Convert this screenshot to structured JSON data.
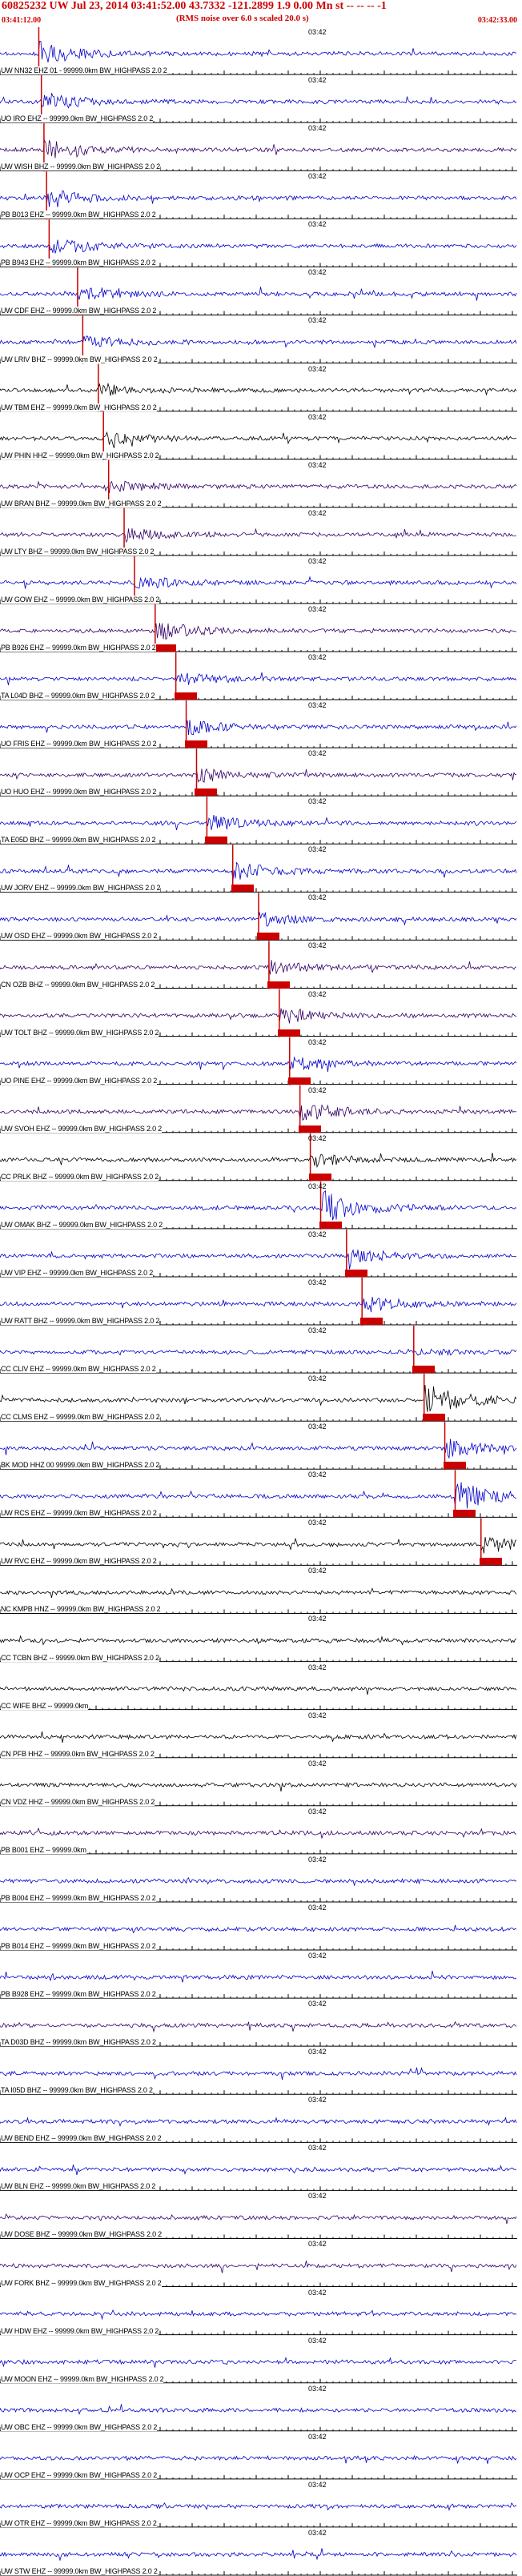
{
  "header": {
    "title": "60825232 UW Jul 23, 2014 03:41:52.00   43.7332 -121.2899  1.9 0.00 Mn st -- -- -- -1",
    "note": "(RMS noise over 6.0 s scaled 20.0 s)",
    "start_time": "03:41:12.00",
    "end_time": "03:42:33.00"
  },
  "time_marker": "03:42",
  "colors": {
    "pick": "#cc0000",
    "blue": "#0000cc",
    "purple": "#330066",
    "black": "#000000"
  },
  "traces": [
    {
      "label": "UW NN32 EHZ 01 - 99999.0km BW_HIGHPASS  2.0  2",
      "color": "blue",
      "pick": 0.075,
      "amp": 14
    },
    {
      "label": "UO IRO EHZ -- 99999.0km BW_HIGHPASS  2.0  2",
      "color": "blue",
      "pick": 0.08,
      "amp": 12
    },
    {
      "label": "UW WISH BHZ -- 99999.0km BW_HIGHPASS  2.0  2",
      "color": "purple",
      "pick": 0.085,
      "amp": 12
    },
    {
      "label": "PB B013 EHZ -- 99999.0km BW_HIGHPASS  2.0  2",
      "color": "blue",
      "pick": 0.09,
      "amp": 12
    },
    {
      "label": "PB B943 EHZ -- 99999.0km BW_HIGHPASS  2.0  2",
      "color": "blue",
      "pick": 0.095,
      "amp": 12
    },
    {
      "label": "UW CDF EHZ -- 99999.0km BW_HIGHPASS  2.0  2",
      "color": "blue",
      "pick": 0.15,
      "amp": 8
    },
    {
      "label": "UW LRIV BHZ -- 99999.0km BW_HIGHPASS  2.0  2",
      "color": "blue",
      "pick": 0.16,
      "amp": 8
    },
    {
      "label": "UW TBM EHZ -- 99999.0km BW_HIGHPASS  2.0  2",
      "color": "black",
      "pick": 0.19,
      "amp": 8
    },
    {
      "label": "UW PHIN HHZ -- 99999.0km BW_HIGHPASS  2.0  2",
      "color": "black",
      "pick": 0.2,
      "amp": 8
    },
    {
      "label": "UW BRAN BHZ -- 99999.0km BW_HIGHPASS  2.0  2",
      "color": "purple",
      "pick": 0.21,
      "amp": 8
    },
    {
      "label": "UW LTY BHZ -- 99999.0km BW_HIGHPASS  2.0  2",
      "color": "purple",
      "pick": 0.24,
      "amp": 8
    },
    {
      "label": "UW GOW EHZ -- 99999.0km BW_HIGHPASS  2.0  2",
      "color": "blue",
      "pick": 0.26,
      "amp": 8
    },
    {
      "label": "PB B926 EHZ -- 99999.0km BW_HIGHPASS  2.0  2",
      "color": "purple",
      "pick": 0.3,
      "amp": 12
    },
    {
      "label": "TA L04D BHZ -- 99999.0km BW_HIGHPASS  2.0  2",
      "color": "blue",
      "pick": 0.34,
      "amp": 8
    },
    {
      "label": "UO FRIS EHZ -- 99999.0km BW_HIGHPASS  2.0  2",
      "color": "blue",
      "pick": 0.36,
      "amp": 10
    },
    {
      "label": "UO HUO EHZ -- 99999.0km BW_HIGHPASS  2.0  2",
      "color": "purple",
      "pick": 0.38,
      "amp": 8
    },
    {
      "label": "TA E05D BHZ -- 99999.0km BW_HIGHPASS  2.0  2",
      "color": "blue",
      "pick": 0.4,
      "amp": 10
    },
    {
      "label": "UW JORV EHZ -- 99999.0km BW_HIGHPASS  2.0  2",
      "color": "blue",
      "pick": 0.45,
      "amp": 12
    },
    {
      "label": "UW OSD EHZ -- 99999.0km BW_HIGHPASS  2.0  2",
      "color": "blue",
      "pick": 0.5,
      "amp": 8
    },
    {
      "label": "CN OZB BHZ -- 99999.0km BW_HIGHPASS  2.0  2",
      "color": "purple",
      "pick": 0.52,
      "amp": 8
    },
    {
      "label": "UW TOLT BHZ -- 99999.0km BW_HIGHPASS  2.0  2",
      "color": "purple",
      "pick": 0.54,
      "amp": 10
    },
    {
      "label": "UO PINE EHZ -- 99999.0km BW_HIGHPASS  2.0  2",
      "color": "blue",
      "pick": 0.56,
      "amp": 8
    },
    {
      "label": "UW SVOH EHZ -- 99999.0km BW_HIGHPASS  2.0  2",
      "color": "purple",
      "pick": 0.58,
      "amp": 12
    },
    {
      "label": "CC PRLK BHZ -- 99999.0km BW_HIGHPASS  2.0  2",
      "color": "black",
      "pick": 0.6,
      "amp": 8
    },
    {
      "label": "UW OMAK BHZ -- 99999.0km BW_HIGHPASS  2.0  2",
      "color": "blue",
      "pick": 0.62,
      "amp": 22
    },
    {
      "label": "UW VIP EHZ -- 99999.0km BW_HIGHPASS  2.0  2",
      "color": "blue",
      "pick": 0.67,
      "amp": 10
    },
    {
      "label": "UW RATT BHZ -- 99999.0km BW_HIGHPASS  2.0  2",
      "color": "blue",
      "pick": 0.7,
      "amp": 12
    },
    {
      "label": "CC CLIV EHZ -- 99999.0km BW_HIGHPASS  2.0  2",
      "color": "blue",
      "pick": 0.8,
      "amp": 4
    },
    {
      "label": "CC CLMS EHZ -- 99999.0km BW_HIGHPASS  2.0  2",
      "color": "black",
      "pick": 0.82,
      "amp": 20
    },
    {
      "label": "BK MOD HHZ 00 99999.0km BW_HIGHPASS  2.0  2",
      "color": "blue",
      "pick": 0.86,
      "amp": 12
    },
    {
      "label": "UW RCS EHZ -- 99999.0km BW_HIGHPASS  2.0  2",
      "color": "blue",
      "pick": 0.88,
      "amp": 18
    },
    {
      "label": "UW RVC EHZ -- 99999.0km BW_HIGHPASS  2.0  2",
      "color": "black",
      "pick": 0.93,
      "amp": 10
    },
    {
      "label": "NC KMPB HNZ -- 99999.0km BW_HIGHPASS  2.0  2",
      "color": "black",
      "pick": null,
      "amp": 6
    },
    {
      "label": "CC TCBN BHZ -- 99999.0km BW_HIGHPASS  2.0  2",
      "color": "black",
      "pick": null,
      "amp": 1
    },
    {
      "label": "CC WIFE BHZ -- 99999.0km",
      "color": "black",
      "pick": null,
      "amp": 3
    },
    {
      "label": "CN PFB HHZ -- 99999.0km BW_HIGHPASS  2.0  2",
      "color": "black",
      "pick": null,
      "amp": 3
    },
    {
      "label": "CN VDZ HHZ -- 99999.0km BW_HIGHPASS  2.0  2",
      "color": "black",
      "pick": null,
      "amp": 3
    },
    {
      "label": "PB B001 EHZ -- 99999.0km",
      "color": "purple",
      "pick": null,
      "amp": 3
    },
    {
      "label": "PB B004 EHZ -- 99999.0km BW_HIGHPASS  2.0  2",
      "color": "blue",
      "pick": null,
      "amp": 3
    },
    {
      "label": "PB B014 EHZ -- 99999.0km BW_HIGHPASS  2.0  2",
      "color": "blue",
      "pick": null,
      "amp": 3
    },
    {
      "label": "PB B928 EHZ -- 99999.0km BW_HIGHPASS  2.0  2",
      "color": "blue",
      "pick": null,
      "amp": 3
    },
    {
      "label": "TA D03D BHZ -- 99999.0km BW_HIGHPASS  2.0  2",
      "color": "purple",
      "pick": null,
      "amp": 3
    },
    {
      "label": "TA I05D BHZ -- 99999.0km BW_HIGHPASS  2.0  2",
      "color": "blue",
      "pick": null,
      "amp": 3
    },
    {
      "label": "UW BEND EHZ -- 99999.0km BW_HIGHPASS  2.0  2",
      "color": "blue",
      "pick": null,
      "amp": 3
    },
    {
      "label": "UW BLN EHZ -- 99999.0km BW_HIGHPASS  2.0  2",
      "color": "blue",
      "pick": null,
      "amp": 3
    },
    {
      "label": "UW DOSE BHZ -- 99999.0km BW_HIGHPASS  2.0  2",
      "color": "purple",
      "pick": null,
      "amp": 3
    },
    {
      "label": "UW FORK BHZ -- 99999.0km BW_HIGHPASS  2.0  2",
      "color": "purple",
      "pick": null,
      "amp": 3
    },
    {
      "label": "UW HDW EHZ -- 99999.0km BW_HIGHPASS  2.0  2",
      "color": "blue",
      "pick": null,
      "amp": 3
    },
    {
      "label": "UW MOON EHZ -- 99999.0km BW_HIGHPASS  2.0  2",
      "color": "blue",
      "pick": null,
      "amp": 3
    },
    {
      "label": "UW OBC EHZ -- 99999.0km BW_HIGHPASS  2.0  2",
      "color": "blue",
      "pick": null,
      "amp": 3
    },
    {
      "label": "UW OCP EHZ -- 99999.0km BW_HIGHPASS  2.0  2",
      "color": "blue",
      "pick": null,
      "amp": 3
    },
    {
      "label": "UW OTR EHZ -- 99999.0km BW_HIGHPASS  2.0  2",
      "color": "blue",
      "pick": null,
      "amp": 3
    },
    {
      "label": "UW STW EHZ -- 99999.0km BW_HIGHPASS  2.0  2",
      "color": "blue",
      "pick": null,
      "amp": 3
    }
  ]
}
